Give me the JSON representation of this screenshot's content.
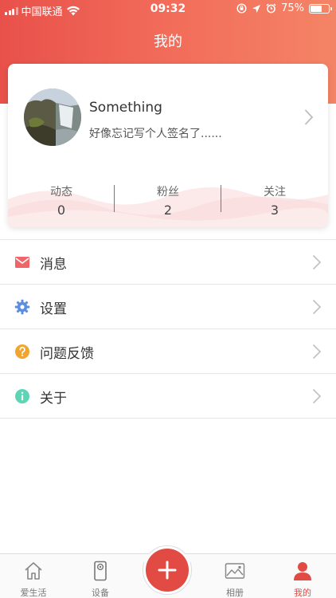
{
  "status_bar": {
    "carrier": "中国联通",
    "time": "09:32",
    "battery_percent": "75%",
    "battery_level": 0.75
  },
  "header": {
    "title": "我的",
    "accent_color": "#e8514a"
  },
  "profile": {
    "username": "Something",
    "signature": "好像忘记写个人签名了......",
    "stats": [
      {
        "label": "动态",
        "value": "0"
      },
      {
        "label": "粉丝",
        "value": "2"
      },
      {
        "label": "关注",
        "value": "3"
      }
    ]
  },
  "menu": {
    "items": [
      {
        "label": "消息",
        "icon": "mail-icon",
        "color": "#f0656a"
      },
      {
        "label": "设置",
        "icon": "gear-icon",
        "color": "#5b8de0"
      },
      {
        "label": "问题反馈",
        "icon": "question-icon",
        "color": "#f2a52e"
      },
      {
        "label": "关于",
        "icon": "info-icon",
        "color": "#5fd4b4"
      }
    ]
  },
  "tabbar": {
    "tabs": [
      {
        "label": "爱生活",
        "icon": "home-icon",
        "active": false
      },
      {
        "label": "设备",
        "icon": "device-icon",
        "active": false
      },
      {
        "label": "",
        "icon": "plus-icon",
        "active": false
      },
      {
        "label": "相册",
        "icon": "album-icon",
        "active": false
      },
      {
        "label": "我的",
        "icon": "person-icon",
        "active": true
      }
    ],
    "active_color": "#e24a44"
  }
}
